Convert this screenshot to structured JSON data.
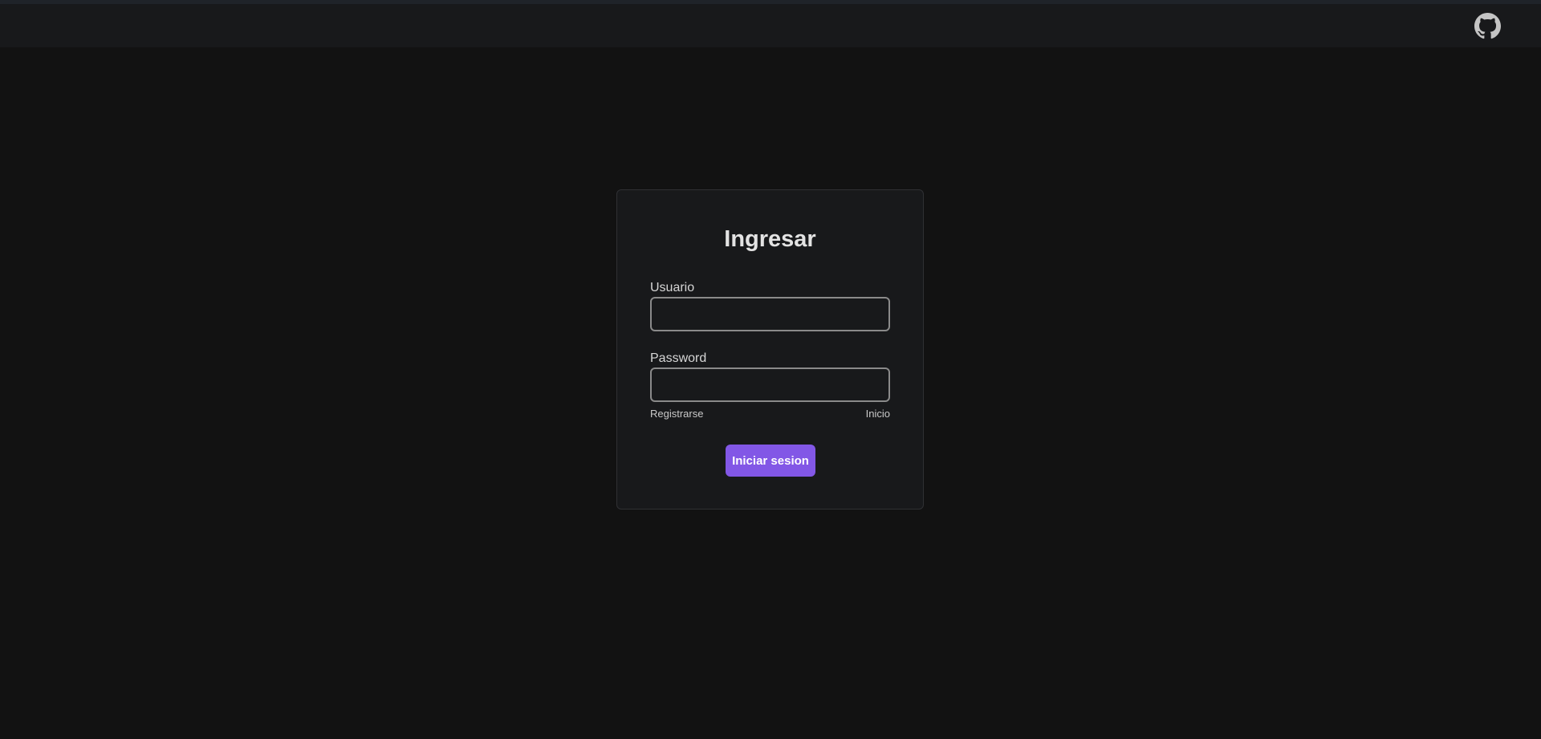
{
  "navbar": {
    "github_icon": "github-icon"
  },
  "login": {
    "title": "Ingresar",
    "username_label": "Usuario",
    "username_value": "",
    "password_label": "Password",
    "password_value": "",
    "register_link": "Registrarse",
    "home_link": "Inicio",
    "submit_label": "Iniciar sesion"
  },
  "colors": {
    "background": "#121212",
    "navbar": "#18191b",
    "card": "#18191b",
    "accent": "#8257e6",
    "text": "#e3e3e3"
  }
}
